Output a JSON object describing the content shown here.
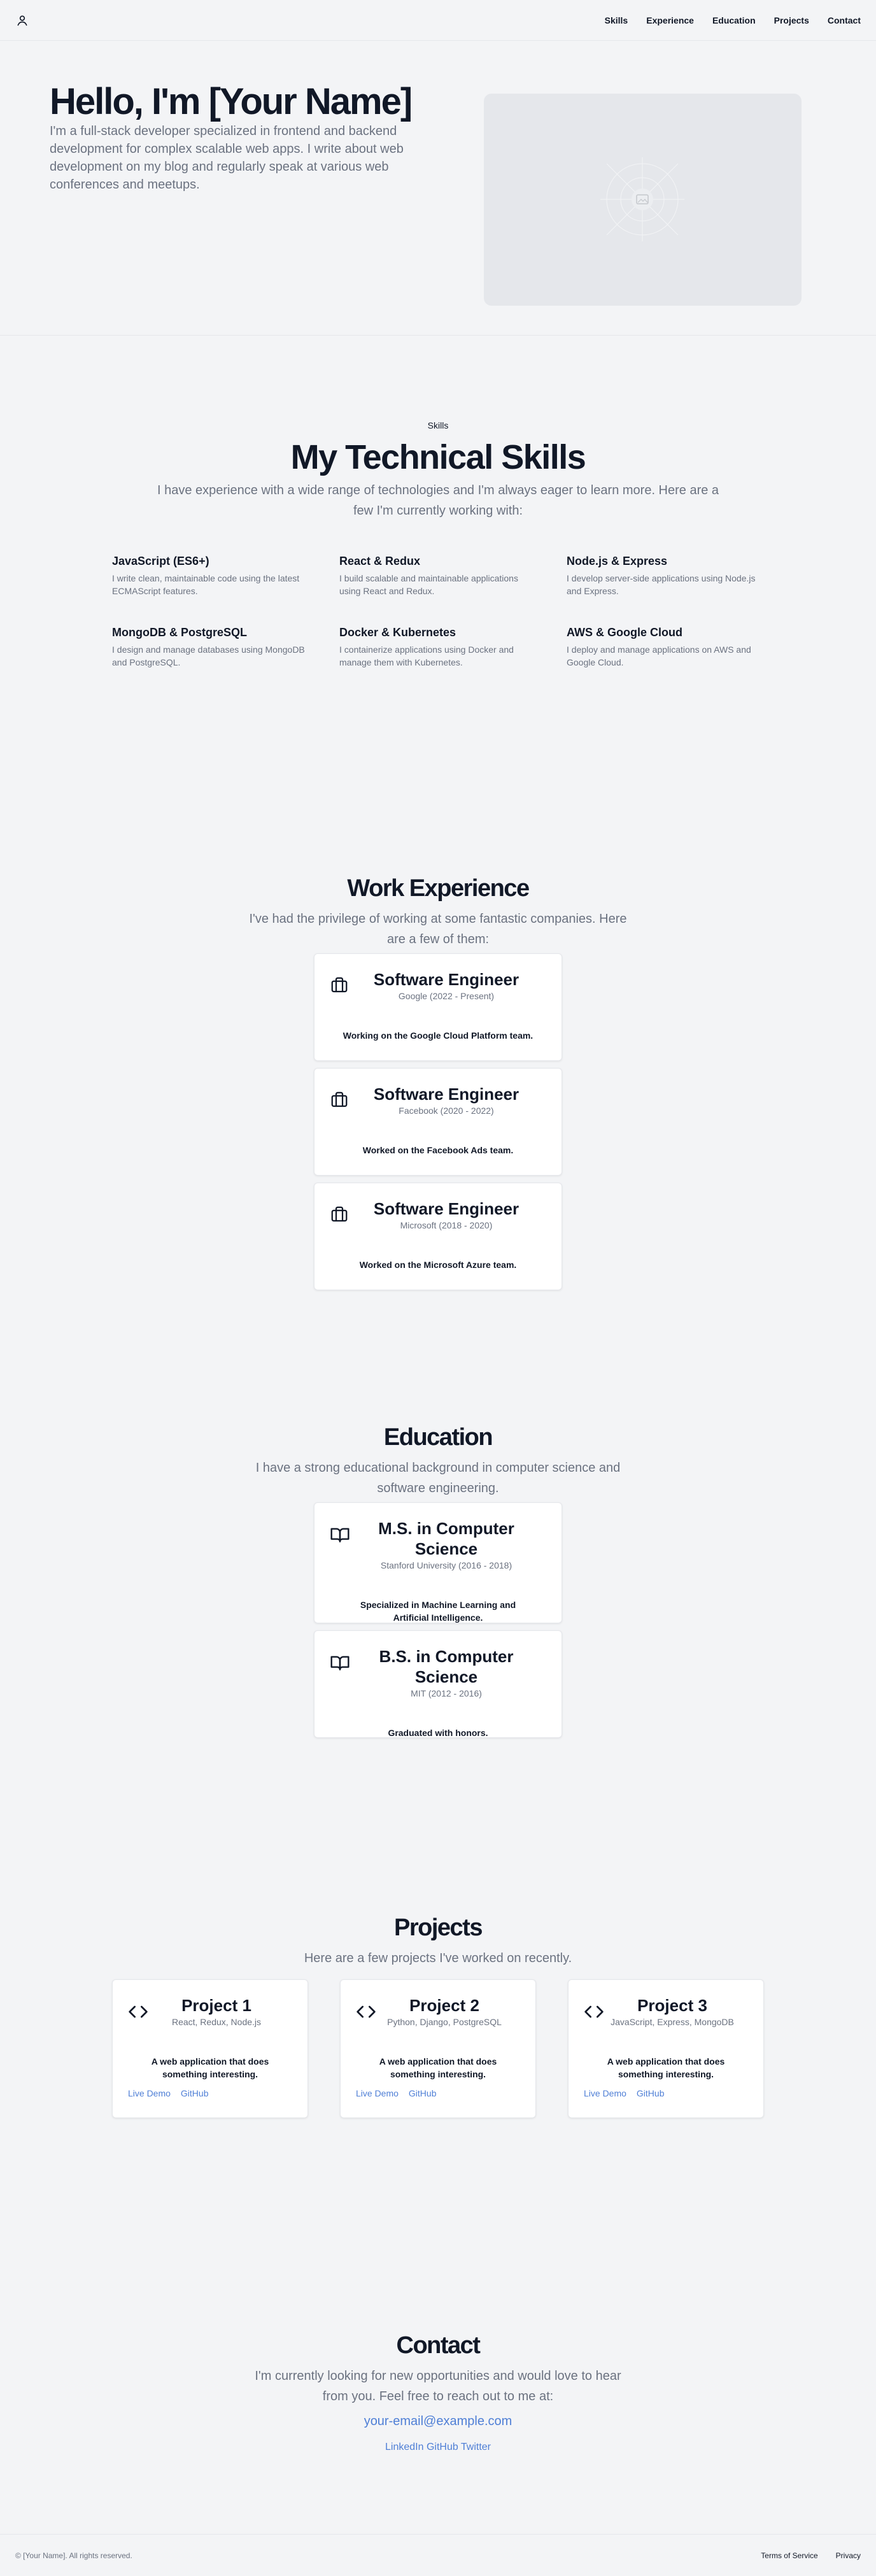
{
  "header": {
    "nav": [
      "Skills",
      "Experience",
      "Education",
      "Projects",
      "Contact"
    ]
  },
  "hero": {
    "title": "Hello, I'm [Your Name]",
    "subtitle": "I'm a full-stack developer specialized in frontend and backend development for complex scalable web apps. I write about web development on my blog and regularly speak at various web conferences and meetups."
  },
  "skills": {
    "eyebrow": "Skills",
    "title": "My Technical Skills",
    "subtitle": "I have experience with a wide range of technologies and I'm always eager to learn more. Here are a few I'm currently working with:",
    "items": [
      {
        "name": "JavaScript (ES6+)",
        "desc": "I write clean, maintainable code using the latest ECMAScript features."
      },
      {
        "name": "React & Redux",
        "desc": "I build scalable and maintainable applications using React and Redux."
      },
      {
        "name": "Node.js & Express",
        "desc": "I develop server-side applications using Node.js and Express."
      },
      {
        "name": "MongoDB & PostgreSQL",
        "desc": "I design and manage databases using MongoDB and PostgreSQL."
      },
      {
        "name": "Docker & Kubernetes",
        "desc": "I containerize applications using Docker and manage them with Kubernetes."
      },
      {
        "name": "AWS & Google Cloud",
        "desc": "I deploy and manage applications on AWS and Google Cloud."
      }
    ]
  },
  "experience": {
    "title": "Work Experience",
    "subtitle": "I've had the privilege of working at some fantastic companies. Here are a few of them:",
    "items": [
      {
        "role": "Software Engineer",
        "meta": "Google (2022 - Present)",
        "desc": "Working on the Google Cloud Platform team."
      },
      {
        "role": "Software Engineer",
        "meta": "Facebook (2020 - 2022)",
        "desc": "Worked on the Facebook Ads team."
      },
      {
        "role": "Software Engineer",
        "meta": "Microsoft (2018 - 2020)",
        "desc": "Worked on the Microsoft Azure team."
      }
    ]
  },
  "education": {
    "title": "Education",
    "subtitle": "I have a strong educational background in computer science and software engineering.",
    "items": [
      {
        "degree": "M.S. in Computer Science",
        "meta": "Stanford University (2016 - 2018)",
        "desc": "Specialized in Machine Learning and Artificial Intelligence."
      },
      {
        "degree": "B.S. in Computer Science",
        "meta": "MIT (2012 - 2016)",
        "desc": "Graduated with honors."
      }
    ]
  },
  "projects": {
    "title": "Projects",
    "subtitle": "Here are a few projects I've worked on recently.",
    "items": [
      {
        "name": "Project 1",
        "tech": "React, Redux, Node.js",
        "desc": "A web application that does something interesting.",
        "demo": "Live Demo",
        "github": "GitHub"
      },
      {
        "name": "Project 2",
        "tech": "Python, Django, PostgreSQL",
        "desc": "A web application that does something interesting.",
        "demo": "Live Demo",
        "github": "GitHub"
      },
      {
        "name": "Project 3",
        "tech": "JavaScript, Express, MongoDB",
        "desc": "A web application that does something interesting.",
        "demo": "Live Demo",
        "github": "GitHub"
      }
    ]
  },
  "contact": {
    "title": "Contact",
    "subtitle": "I'm currently looking for new opportunities and would love to hear from you. Feel free to reach out to me at:",
    "email": "your-email@example.com",
    "social": [
      "LinkedIn",
      "GitHub",
      "Twitter"
    ]
  },
  "footer": {
    "copyright": "© [Your Name]. All rights reserved.",
    "links": [
      "Terms of Service",
      "Privacy"
    ]
  },
  "colors": {
    "background": "#f3f4f6",
    "text": "#111827",
    "muted": "#6b7280",
    "link": "#4f7fd6"
  },
  "icons": {
    "logo": "user-icon",
    "experience": "briefcase-icon",
    "education": "book-open-icon",
    "projects": "code-icon",
    "hero_image": "image-placeholder-icon"
  }
}
